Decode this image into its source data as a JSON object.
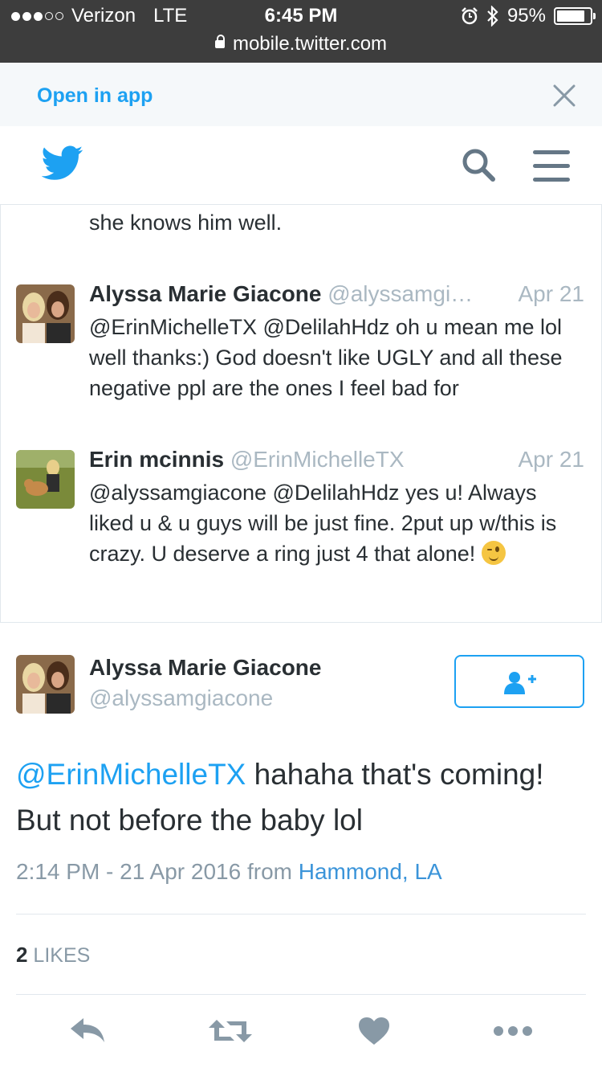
{
  "status_bar": {
    "carrier": "Verizon",
    "network": "LTE",
    "time": "6:45 PM",
    "url": "mobile.twitter.com",
    "battery": "95%",
    "battery_level": 0.95
  },
  "open_app_bar": {
    "label": "Open in app"
  },
  "previous_tweet": {
    "text": "she knows him well."
  },
  "replies": [
    {
      "name": "Alyssa Marie Giacone",
      "handle": "@alyssamgi…",
      "date": "Apr 21",
      "text": "@ErinMichelleTX @DelilahHdz oh u mean me lol well thanks:) God doesn't like UGLY and all these negative ppl are the ones I feel bad for"
    },
    {
      "name": "Erin mcinnis",
      "handle": "@ErinMichelleTX",
      "date": "Apr 21",
      "text": "@alyssamgiacone @DelilahHdz yes u! Always liked u & u guys will be just fine. 2put up w/this is crazy. U deserve a ring just 4 that alone!",
      "emoji": "winking-face"
    }
  ],
  "main_tweet": {
    "name": "Alyssa Marie Giacone",
    "handle": "@alyssamgiacone",
    "mention": "@ErinMichelleTX",
    "text": " hahaha that's coming! But not before the baby lol",
    "time": "2:14 PM - 21 Apr 2016",
    "from_label": "from",
    "place": "Hammond, LA",
    "likes_count": "2",
    "likes_label": "LIKES"
  },
  "colors": {
    "twitter_blue": "#1da1f2",
    "icon_gray": "#657786",
    "muted_text": "#aab8c2"
  }
}
